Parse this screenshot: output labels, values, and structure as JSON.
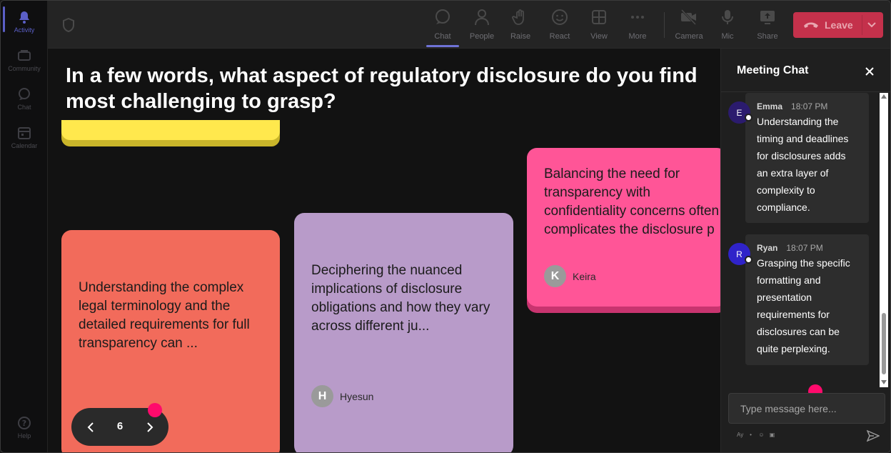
{
  "rail": {
    "items": [
      {
        "label": "Activity",
        "icon": "bell-icon",
        "active": true
      },
      {
        "label": "Community",
        "icon": "community-icon"
      },
      {
        "label": "Chat",
        "icon": "chat-icon"
      },
      {
        "label": "Calendar",
        "icon": "calendar-icon"
      }
    ],
    "help": {
      "label": "Help",
      "icon": "help-icon"
    }
  },
  "toolbar": {
    "buttons": [
      {
        "label": "Chat",
        "icon": "chat-icon",
        "active": true
      },
      {
        "label": "People",
        "icon": "people-icon"
      },
      {
        "label": "Raise",
        "icon": "raise-hand-icon"
      },
      {
        "label": "React",
        "icon": "react-smiley-icon"
      },
      {
        "label": "View",
        "icon": "view-grid-icon"
      },
      {
        "label": "More",
        "icon": "more-dots-icon"
      },
      {
        "label": "Camera",
        "icon": "camera-off-icon"
      },
      {
        "label": "Mic",
        "icon": "mic-icon"
      },
      {
        "label": "Share",
        "icon": "share-icon"
      }
    ],
    "leave_label": "Leave",
    "leave_color": "#c4314b"
  },
  "main": {
    "question": "In a few words, what aspect of regulatory disclosure do you find most challenging to grasp?",
    "notes": [
      {
        "color": "#ffe84d",
        "text": ""
      },
      {
        "color": "#f26b5b",
        "text": "Understanding the complex legal terminology and the detailed requirements for full transparency can ..."
      },
      {
        "color": "#b89bc9",
        "text": "Deciphering the nuanced implications of disclosure obligations and how they vary across different ju...",
        "author": "Hyesun",
        "initial": "H"
      },
      {
        "color": "#ff5597",
        "text": "Balancing the need for transparency with confidentiality concerns often complicates the disclosure p",
        "author": "Keira",
        "initial": "K"
      }
    ],
    "pager": {
      "page": "6"
    }
  },
  "chat": {
    "title": "Meeting Chat",
    "messages": [
      {
        "name": "Emma",
        "initial": "E",
        "time": "18:07 PM",
        "text": "Understanding the timing and deadlines for disclosures adds an extra layer of complexity to compliance.",
        "avatar_color": "#2b1b6e"
      },
      {
        "name": "Ryan",
        "initial": "R",
        "time": "18:07 PM",
        "text": "Grasping the specific formatting and presentation requirements for disclosures can be quite perplexing.",
        "avatar_color": "#2f23c9"
      }
    ],
    "input_placeholder": "Type message here..."
  },
  "colors": {
    "accent": "#5b5fc7",
    "indicator": "#ff0a6c"
  }
}
